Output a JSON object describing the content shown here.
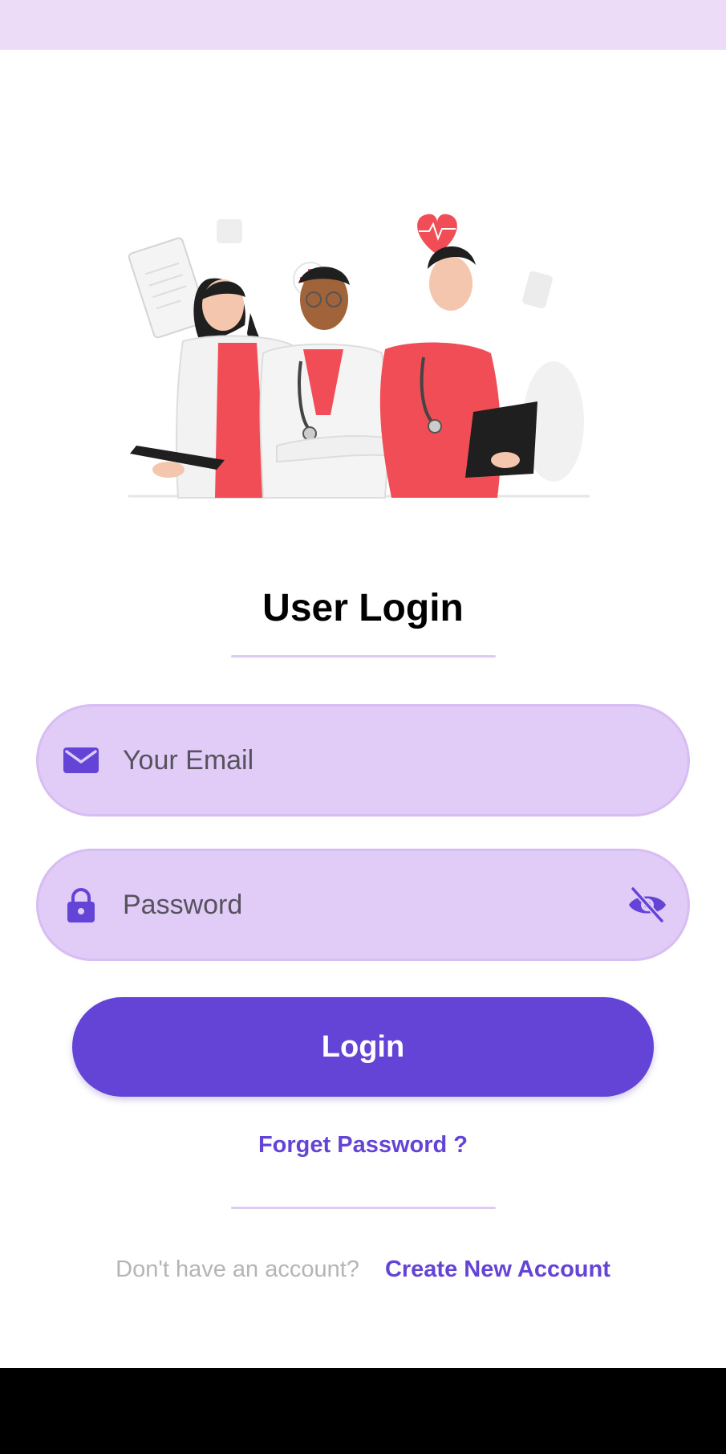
{
  "colors": {
    "accent": "#6444d6",
    "field_background": "#e1ccf7",
    "status_bar": "#ecdcf8",
    "illustration_red": "#f14d57"
  },
  "login": {
    "title": "User Login",
    "email": {
      "icon": "mail-icon",
      "placeholder": "Your Email",
      "value": ""
    },
    "password": {
      "icon": "lock-icon",
      "placeholder": "Password",
      "value": "",
      "toggle_icon": "eye-off-icon"
    },
    "submit_label": "Login",
    "forgot_label": "Forget Password ?",
    "signup_prompt": "Don't have an account?",
    "signup_link": "Create New Account"
  }
}
